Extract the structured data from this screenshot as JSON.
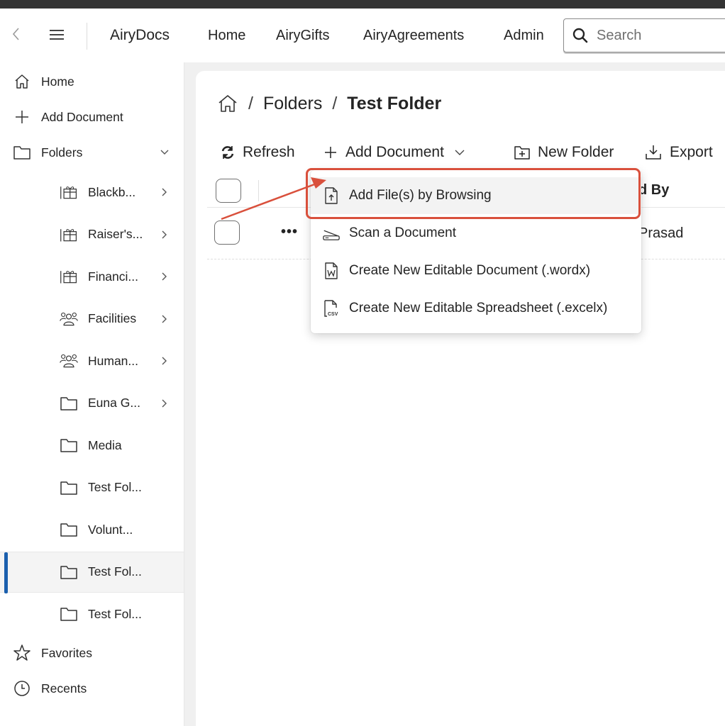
{
  "header": {
    "app_name": "AiryDocs",
    "nav": [
      "Home",
      "AiryGifts",
      "AiryAgreements",
      "Admin"
    ],
    "search_placeholder": "Search"
  },
  "sidebar": {
    "home": "Home",
    "add_document": "Add Document",
    "folders": "Folders",
    "folder_items": [
      {
        "label": "Blackb...",
        "icon": "gift-icon",
        "has_chevron": true
      },
      {
        "label": "Raiser's...",
        "icon": "gift-icon",
        "has_chevron": true
      },
      {
        "label": "Financi...",
        "icon": "gift-icon",
        "has_chevron": true
      },
      {
        "label": "Facilities",
        "icon": "people-icon",
        "has_chevron": true
      },
      {
        "label": "Human...",
        "icon": "people-icon",
        "has_chevron": true
      },
      {
        "label": "Euna G...",
        "icon": "folder-icon",
        "has_chevron": true
      },
      {
        "label": "Media",
        "icon": "folder-icon",
        "has_chevron": false
      },
      {
        "label": "Test Fol...",
        "icon": "folder-icon",
        "has_chevron": false
      },
      {
        "label": "Volunt...",
        "icon": "folder-icon",
        "has_chevron": false
      },
      {
        "label": "Test Fol...",
        "icon": "folder-icon",
        "has_chevron": false,
        "selected": true
      },
      {
        "label": "Test Fol...",
        "icon": "folder-icon",
        "has_chevron": false
      }
    ],
    "favorites": "Favorites",
    "recents": "Recents"
  },
  "breadcrumb": {
    "sep": "/",
    "folders": "Folders",
    "current": "Test Folder"
  },
  "toolbar": {
    "refresh": "Refresh",
    "add_document": "Add Document",
    "new_folder": "New Folder",
    "export": "Export"
  },
  "grid": {
    "column_partial": "d By",
    "row_more": "•••",
    "row_cell_partial": "Prasad"
  },
  "dropdown": {
    "items": [
      {
        "label": "Add File(s) by Browsing",
        "icon": "file-upload-icon"
      },
      {
        "label": "Scan a Document",
        "icon": "scanner-icon"
      },
      {
        "label": "Create New Editable Document (.wordx)",
        "icon": "word-file-icon"
      },
      {
        "label": "Create New Editable Spreadsheet (.excelx)",
        "icon": "csv-file-icon"
      }
    ]
  },
  "colors": {
    "accent": "#1b5fad",
    "annotation": "#d9503c"
  }
}
